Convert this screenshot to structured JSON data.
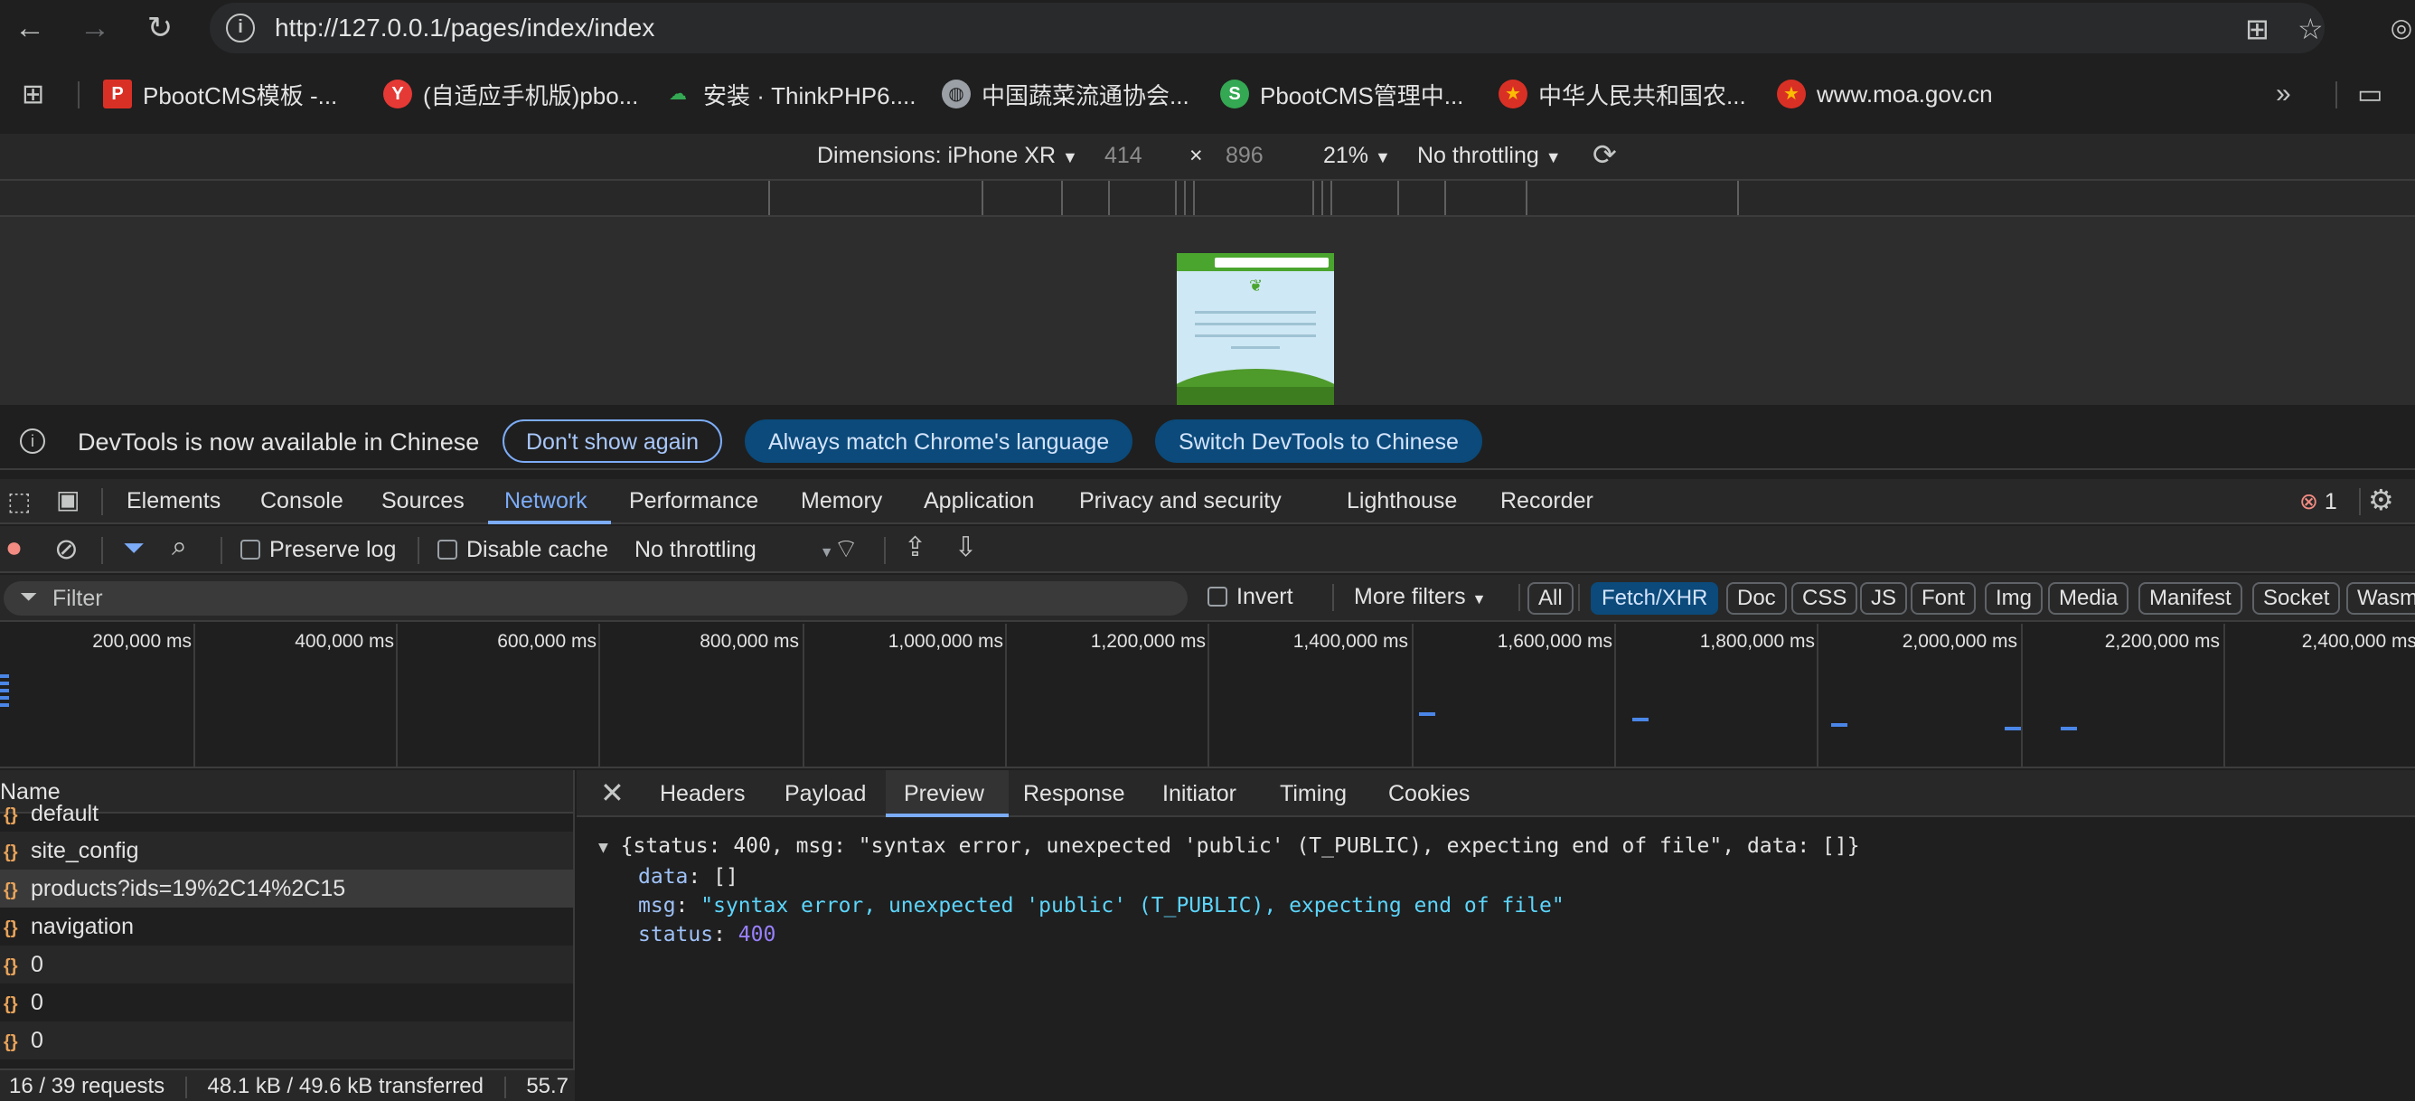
{
  "browser": {
    "url": "http://127.0.0.1/pages/index/index",
    "bookmarks": [
      {
        "label": "PbootCMS模板 -...",
        "color": "#d93025"
      },
      {
        "label": "(自适应手机版)pbo...",
        "color": "#e53935"
      },
      {
        "label": "安装 · ThinkPHP6....",
        "color": "#2e7d32"
      },
      {
        "label": "中国蔬菜流通协会...",
        "color": "#9aa0a6"
      },
      {
        "label": "PbootCMS管理中...",
        "color": "#34a853"
      },
      {
        "label": "中华人民共和国农...",
        "color": "#d93025"
      },
      {
        "label": "www.moa.gov.cn",
        "color": "#d93025"
      }
    ]
  },
  "device_toolbar": {
    "dimensions_label": "Dimensions: iPhone XR",
    "width": "414",
    "times": "×",
    "height": "896",
    "zoom": "21%",
    "throttling": "No throttling"
  },
  "banner": {
    "message": "DevTools is now available in Chinese",
    "btn_dont_show": "Don't show again",
    "btn_match": "Always match Chrome's language",
    "btn_switch": "Switch DevTools to Chinese"
  },
  "devtools_tabs": [
    "Elements",
    "Console",
    "Sources",
    "Network",
    "Performance",
    "Memory",
    "Application",
    "Privacy and security",
    "Lighthouse",
    "Recorder"
  ],
  "active_tab": "Network",
  "error_count": "1",
  "network_toolbar": {
    "preserve_log": "Preserve log",
    "disable_cache": "Disable cache",
    "throttling": "No throttling"
  },
  "filter": {
    "placeholder": "Filter",
    "invert": "Invert",
    "more_filters": "More filters",
    "chips": [
      "All",
      "Fetch/XHR",
      "Doc",
      "CSS",
      "JS",
      "Font",
      "Img",
      "Media",
      "Manifest",
      "Socket",
      "Wasm"
    ],
    "active_chip": "Fetch/XHR"
  },
  "overview": {
    "labels": [
      "200,000 ms",
      "400,000 ms",
      "600,000 ms",
      "800,000 ms",
      "1,000,000 ms",
      "1,200,000 ms",
      "1,400,000 ms",
      "1,600,000 ms",
      "1,800,000 ms",
      "2,000,000 ms",
      "2,200,000 ms",
      "2,400,000 ms"
    ]
  },
  "requests": {
    "header": "Name",
    "items": [
      "default",
      "site_config",
      "products?ids=19%2C14%2C15",
      "navigation",
      "0",
      "0",
      "0"
    ],
    "selected": "products?ids=19%2C14%2C15"
  },
  "status_bar": {
    "requests": "16 / 39 requests",
    "transferred": "48.1 kB / 49.6 kB transferred",
    "resources": "55.7"
  },
  "detail_tabs": [
    "Headers",
    "Payload",
    "Preview",
    "Response",
    "Initiator",
    "Timing",
    "Cookies"
  ],
  "active_detail_tab": "Preview",
  "preview": {
    "summary": "{status: 400, msg: \"syntax error, unexpected 'public' (T_PUBLIC), expecting end of file\", data: []}",
    "data_key": "data",
    "data_val": "[]",
    "msg_key": "msg",
    "msg_val": "\"syntax error, unexpected 'public' (T_PUBLIC), expecting end of file\"",
    "status_key": "status",
    "status_val": "400"
  }
}
